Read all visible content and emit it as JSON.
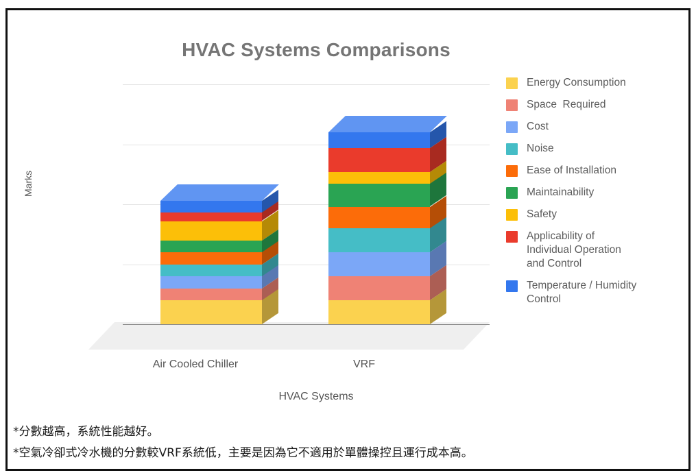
{
  "top_fragment": " ",
  "chart_data": {
    "type": "bar",
    "subtype": "stacked-3d-column",
    "title": "HVAC Systems Comparisons",
    "xlabel": "HVAC Systems",
    "ylabel": "Marks",
    "ylim": [
      0,
      20
    ],
    "yticks": [
      "0",
      "5",
      "10",
      "15",
      "20"
    ],
    "ytick_values": [
      0,
      5,
      10,
      15,
      20
    ],
    "grid": true,
    "legend_position": "right",
    "categories": [
      "Air Cooled Chiller",
      "VRF"
    ],
    "series": [
      {
        "name": "Energy Consumption",
        "color": "#FBD24F",
        "values": [
          2.0,
          2.0
        ]
      },
      {
        "name": "Space  Required",
        "color": "#EF8275",
        "values": [
          1.0,
          2.0
        ]
      },
      {
        "name": "Cost",
        "color": "#7BA7F7",
        "values": [
          1.0,
          2.0
        ]
      },
      {
        "name": "Noise",
        "color": "#45BDC6",
        "values": [
          1.0,
          2.0
        ]
      },
      {
        "name": "Ease of Installation",
        "color": "#FC6C09",
        "values": [
          1.0,
          1.8
        ]
      },
      {
        "name": "Maintainability",
        "color": "#2AA453",
        "values": [
          1.0,
          1.9
        ]
      },
      {
        "name": "Safety",
        "color": "#FCBF08",
        "values": [
          1.6,
          1.0
        ]
      },
      {
        "name": "Applicability of\nIndividual Operation\nand Control",
        "color": "#EA3B2C",
        "values": [
          0.7,
          2.0
        ]
      },
      {
        "name": "Temperature / Humidity\nControl",
        "color": "#3377EE",
        "values": [
          1.0,
          1.3
        ]
      }
    ],
    "totals": [
      10.3,
      16.0
    ]
  },
  "legend": {
    "items": [
      {
        "label": "Energy Consumption",
        "color": "#FBD24F"
      },
      {
        "label": "Space  Required",
        "color": "#EF8275"
      },
      {
        "label": "Cost",
        "color": "#7BA7F7"
      },
      {
        "label": "Noise",
        "color": "#45BDC6"
      },
      {
        "label": "Ease of Installation",
        "color": "#FC6C09"
      },
      {
        "label": "Maintainability",
        "color": "#2AA453"
      },
      {
        "label": "Safety",
        "color": "#FCBF08"
      },
      {
        "label": "Applicability of\nIndividual Operation\nand Control",
        "color": "#EA3B2C"
      },
      {
        "label": "Temperature / Humidity\nControl",
        "color": "#3377EE"
      }
    ]
  },
  "notes": [
    "*分數越高，系統性能越好。",
    "*空氣冷卻式冷水機的分數較VRF系統低，主要是因為它不適用於單體操控且運行成本高。"
  ]
}
